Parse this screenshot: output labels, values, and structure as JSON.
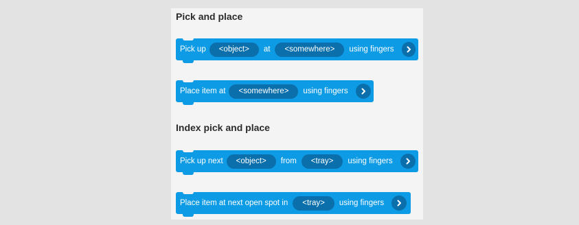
{
  "sections": [
    {
      "title": "Pick and place",
      "blocks": [
        {
          "parts": [
            {
              "type": "text",
              "value": "Pick up"
            },
            {
              "type": "slot",
              "value": "<object>"
            },
            {
              "type": "text",
              "value": "at"
            },
            {
              "type": "slot",
              "value": "<somewhere>"
            },
            {
              "type": "text",
              "value": "using fingers"
            }
          ],
          "action_icon": "chevron-right-icon"
        },
        {
          "parts": [
            {
              "type": "text",
              "value": "Place item at"
            },
            {
              "type": "slot",
              "value": "<somewhere>"
            },
            {
              "type": "text",
              "value": "using fingers"
            }
          ],
          "action_icon": "chevron-right-icon"
        }
      ]
    },
    {
      "title": "Index pick and place",
      "blocks": [
        {
          "parts": [
            {
              "type": "text",
              "value": "Pick up next"
            },
            {
              "type": "slot",
              "value": "<object>"
            },
            {
              "type": "text",
              "value": "from"
            },
            {
              "type": "slot",
              "value": "<tray>"
            },
            {
              "type": "text",
              "value": "using fingers"
            }
          ],
          "action_icon": "chevron-right-icon"
        },
        {
          "parts": [
            {
              "type": "text",
              "value": "Place item at next open spot in"
            },
            {
              "type": "slot",
              "value": "<tray>"
            },
            {
              "type": "text",
              "value": "using fingers"
            }
          ],
          "action_icon": "chevron-right-icon"
        }
      ]
    }
  ],
  "colors": {
    "background": "#e3e3e3",
    "panel": "#f4f4f4",
    "block": "#0e9be5",
    "slot": "#0a6fab",
    "block_text": "#ffffff",
    "title_text": "#2b2b2b"
  }
}
